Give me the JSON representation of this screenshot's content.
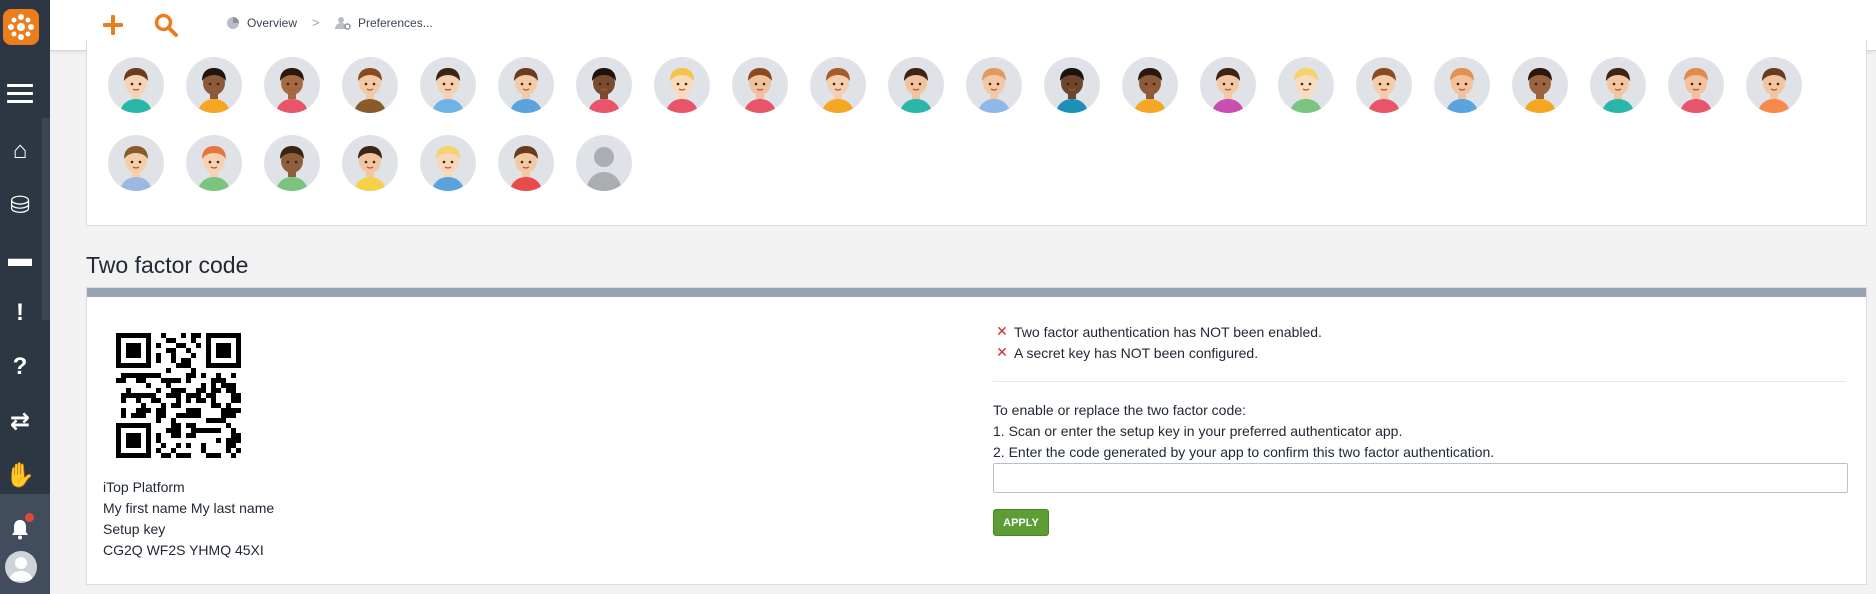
{
  "nav": {
    "items": [
      {
        "name": "home-icon",
        "glyph": "⌂"
      },
      {
        "name": "database-icon",
        "glyph": "⛁"
      },
      {
        "name": "chat-icon",
        "glyph": "▬"
      },
      {
        "name": "alert-icon",
        "glyph": "!"
      },
      {
        "name": "help-icon",
        "glyph": "?"
      },
      {
        "name": "transfer-icon",
        "glyph": "⇄"
      },
      {
        "name": "handshake-icon",
        "glyph": "✋"
      }
    ]
  },
  "topbar": {
    "breadcrumb_overview": "Overview",
    "breadcrumb_separator": ">",
    "breadcrumb_preferences": "Preferences..."
  },
  "avatars": {
    "row1_count": 22,
    "row2_count": 7,
    "skin_tones": [
      "#f7d2b2",
      "#8a5a3b",
      "#a66a43",
      "#f2c9a5",
      "#f5cfae",
      "#f3caa6",
      "#7a4b30",
      "#f8d9ba",
      "#f0c19c",
      "#f4cfae",
      "#f2c39e",
      "#f3c8a4",
      "#6f452d",
      "#8d5a3a",
      "#f2c8a6",
      "#f9dcbd",
      "#f5cba8",
      "#f2c29d",
      "#9a6441",
      "#f3c6a2",
      "#f2c19d",
      "#f2c4a0",
      "#f4cda9",
      "#f7d2b2",
      "#8d5f3d",
      "#f2c4a0",
      "#f7d7b8",
      "#f4c8a2",
      "#bfc4c9"
    ],
    "hair_colors": [
      "#6b3b1f",
      "#1f140e",
      "#2b170d",
      "#8a4a1e",
      "#3d2415",
      "#6b3b1f",
      "#1d120c",
      "#f3c34a",
      "#8a4a1e",
      "#a25d2a",
      "#3d2415",
      "#e49a5d",
      "#1d120c",
      "#2b170d",
      "#3d2415",
      "#f5d26a",
      "#8a4a1e",
      "#e58f53",
      "#2b170d",
      "#3d2415",
      "#e08a4e",
      "#6b3b1f",
      "#8a5a2a",
      "#e6763f",
      "#3b2414",
      "#3d2415",
      "#f5d26a",
      "#6b3b1f",
      "#a9aeb3"
    ],
    "shirt_colors": [
      "#2ab7a9",
      "#f5a623",
      "#e8546a",
      "#8a5a2a",
      "#6fb3e6",
      "#5ba3dd",
      "#e8546a",
      "#e8546a",
      "#e8546a",
      "#f5a623",
      "#2ab7a9",
      "#8fb8e8",
      "#1f8fb8",
      "#f5a623",
      "#c84fb0",
      "#7bc47f",
      "#e8546a",
      "#5ba3dd",
      "#f5a623",
      "#2ab7a9",
      "#e8546a",
      "#f58a4b",
      "#9cb8e0",
      "#7bc47f",
      "#7bc47f",
      "#f5d04b",
      "#5ba3dd",
      "#e84b4b",
      "#a9aeb3"
    ]
  },
  "two_factor": {
    "title": "Two factor code",
    "platform": "iTop Platform",
    "user_name": "My first name My last name",
    "setup_key_label": "Setup key",
    "setup_key_value": "CG2Q WF2S YHMQ 45XI",
    "status_1": "Two factor authentication has NOT been enabled.",
    "status_2": "A secret key has NOT been configured.",
    "instructions_intro": "To enable or replace the two factor code:",
    "instruction_1": "1.  Scan or enter the setup key in your preferred authenticator app.",
    "instruction_2": "2.  Enter the code generated by your app to confirm this two factor authentication.",
    "code_value": "",
    "apply_label": "APPLY"
  }
}
